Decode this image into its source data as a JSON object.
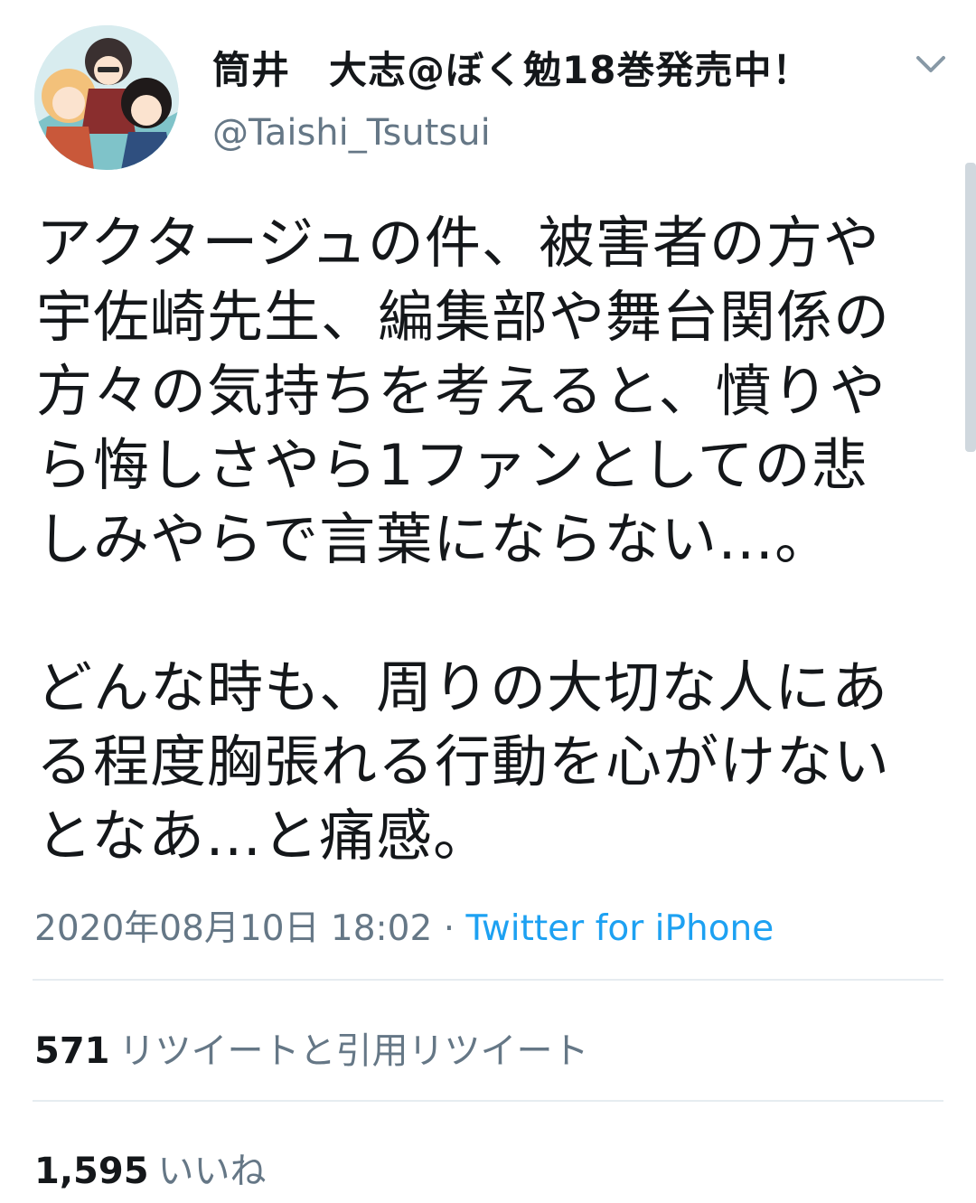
{
  "tweet": {
    "author": {
      "display_name": "筒井　大志@ぼく勉18巻発売中！",
      "handle": "@Taishi_Tsutsui"
    },
    "text": "アクタージュの件、被害者の方や\n宇佐崎先生、編集部や舞台関係の\n方々の気持ちを考えると、憤りや\nら悔しさやら1ファンとしての悲\nしみやらで言葉にならない…。\n\nどんな時も、周りの大切な人にあ\nる程度胸張れる行動を心がけない\nとなあ…と痛感。",
    "timestamp": "2020年08月10日 18:02",
    "separator": "·",
    "source": "Twitter for iPhone",
    "retweets": {
      "count": "571",
      "label": "リツイートと引用リツイート"
    },
    "likes": {
      "count": "1,595",
      "label": "いいね"
    }
  },
  "icons": {
    "menu": "chevron-down-icon"
  },
  "colors": {
    "text_primary": "#14171a",
    "text_secondary": "#657786",
    "link": "#1da1f2",
    "divider": "#e6ecf0"
  }
}
